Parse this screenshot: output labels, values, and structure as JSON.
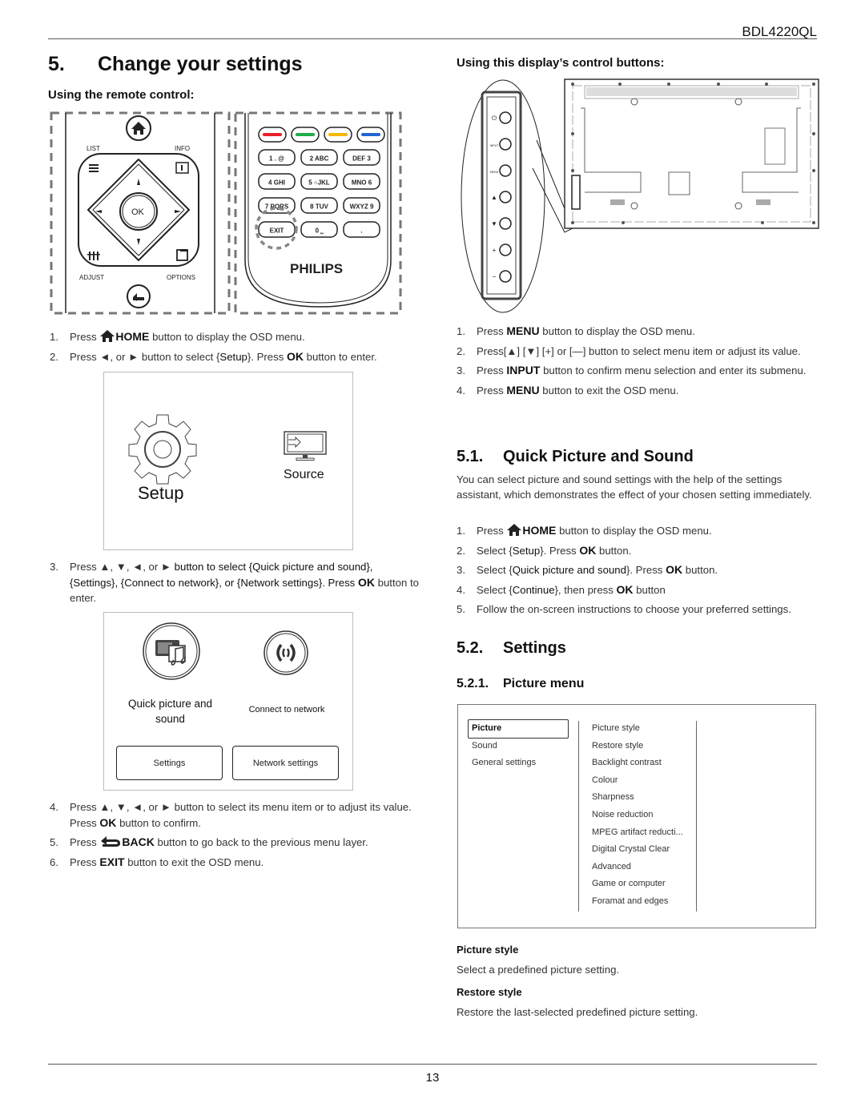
{
  "header": {
    "model": "BDL4220QL"
  },
  "section5": {
    "num": "5.",
    "title": "Change your settings",
    "remote_heading": "Using the remote control:",
    "display_heading": "Using this display’s control buttons:"
  },
  "remote_left": {
    "labels": {
      "list": "LIST",
      "info": "INFO",
      "ok": "OK",
      "adjust": "ADJUST",
      "options": "OPTIONS"
    }
  },
  "remote_right": {
    "color_keys": [
      "#e8202a",
      "#1fae4b",
      "#f6b800",
      "#2166d4"
    ],
    "keys": [
      [
        "1 . @",
        "2 ABC",
        "DEF 3"
      ],
      [
        "4 GHI",
        "5 ○JKL",
        "MNO 6"
      ],
      [
        "7 PQRS",
        "8 TUV",
        "WXYZ 9"
      ],
      [
        "EXIT",
        "0 ⎵",
        "."
      ]
    ],
    "brand": "PHILIPS"
  },
  "remote_steps": [
    {
      "n": "1.",
      "pre": "Press",
      "icon": "home-icon",
      "key": "HOME",
      "post": "button to display the OSD menu."
    },
    {
      "n": "2.",
      "pre": "Press",
      "arrows": "◄, or ►",
      "mid": "button to select {",
      "sel": "Setup",
      "mid2": "}. Press",
      "key": "OK",
      "post": "button to enter."
    },
    {
      "n": "3.",
      "pre": "Press",
      "arrows": "▲, ▼, ◄, or ►",
      "text": "button to select {Quick picture and sound}, {Settings}, {Connect to network}, or {Network settings}. Press",
      "key": "OK",
      "post": "button to enter."
    },
    {
      "n": "4.",
      "pre": "Press",
      "arrows": "▲, ▼, ◄, or ►",
      "text": "button to select its menu item or to adjust its value. Press",
      "key": "OK",
      "post": "button to confirm."
    },
    {
      "n": "5.",
      "pre": "Press",
      "icon": "back-icon",
      "key": "BACK",
      "post": "button to go back to the previous menu layer."
    },
    {
      "n": "6.",
      "pre": "Press",
      "key": "EXIT",
      "post": "button to exit the OSD menu."
    }
  ],
  "home_menu": {
    "setup": "Setup",
    "source": "Source"
  },
  "setup_menu": {
    "quick": "Quick picture and sound",
    "quick_l1": "Quick picture and",
    "quick_l2": "sound",
    "connect": "Connect to network",
    "settings": "Settings",
    "network_settings": "Network settings"
  },
  "display_steps": [
    {
      "n": "1.",
      "pre": "Press",
      "key": "MENU",
      "post": "button to display the OSD menu."
    },
    {
      "n": "2.",
      "pre": "Press[▲] [▼] [+] or [—] button to select menu item or adjust its value."
    },
    {
      "n": "3.",
      "pre": "Press",
      "key": "INPUT",
      "post": "button to confirm menu selection and enter its submenu."
    },
    {
      "n": "4.",
      "pre": "Press",
      "key": "MENU",
      "post": "button to exit the OSD menu."
    }
  ],
  "display_button_labels": [
    "⏻",
    "INPUT",
    "MENU",
    "▲",
    "▼",
    "+",
    "−"
  ],
  "section51": {
    "num": "5.1.",
    "title": "Quick Picture and Sound",
    "intro": "You can select picture and sound settings with the help of the settings assistant, which demonstrates the effect of your chosen setting immediately.",
    "steps": [
      {
        "n": "1.",
        "pre": "Press",
        "key": "HOME",
        "post": "button to display the OSD menu."
      },
      {
        "n": "2.",
        "pre": "Select {",
        "sel": "Setup",
        "mid": "}. Press",
        "key": "OK",
        "post": "button."
      },
      {
        "n": "3.",
        "pre": "Select {",
        "sel": "Quick picture and sound",
        "mid": "}. Press",
        "key": "OK",
        "post": "button."
      },
      {
        "n": "4.",
        "pre": "Select {",
        "sel": "Continue",
        "mid": "}, then press",
        "key": "OK",
        "post": "button"
      },
      {
        "n": "5.",
        "pre": "Follow the on-screen instructions to choose your preferred settings."
      }
    ]
  },
  "section52": {
    "num": "5.2.",
    "title": "Settings"
  },
  "section521": {
    "num": "5.2.1.",
    "title": "Picture menu"
  },
  "picture_menu": {
    "left": [
      "Picture",
      "Sound",
      "General settings"
    ],
    "selected": "Picture",
    "right": [
      "Picture style",
      "Restore style",
      "Backlight contrast",
      "Colour",
      "Sharpness",
      "Noise reduction",
      "MPEG artifact reducti...",
      "Digital Crystal Clear",
      "Advanced",
      "Game or computer",
      "Foramat and edges"
    ]
  },
  "descriptions": [
    {
      "label": "Picture style",
      "text": "Select a predefined picture setting."
    },
    {
      "label": "Restore style",
      "text": "Restore the last-selected predefined picture setting."
    }
  ],
  "footer": {
    "page": "13"
  }
}
